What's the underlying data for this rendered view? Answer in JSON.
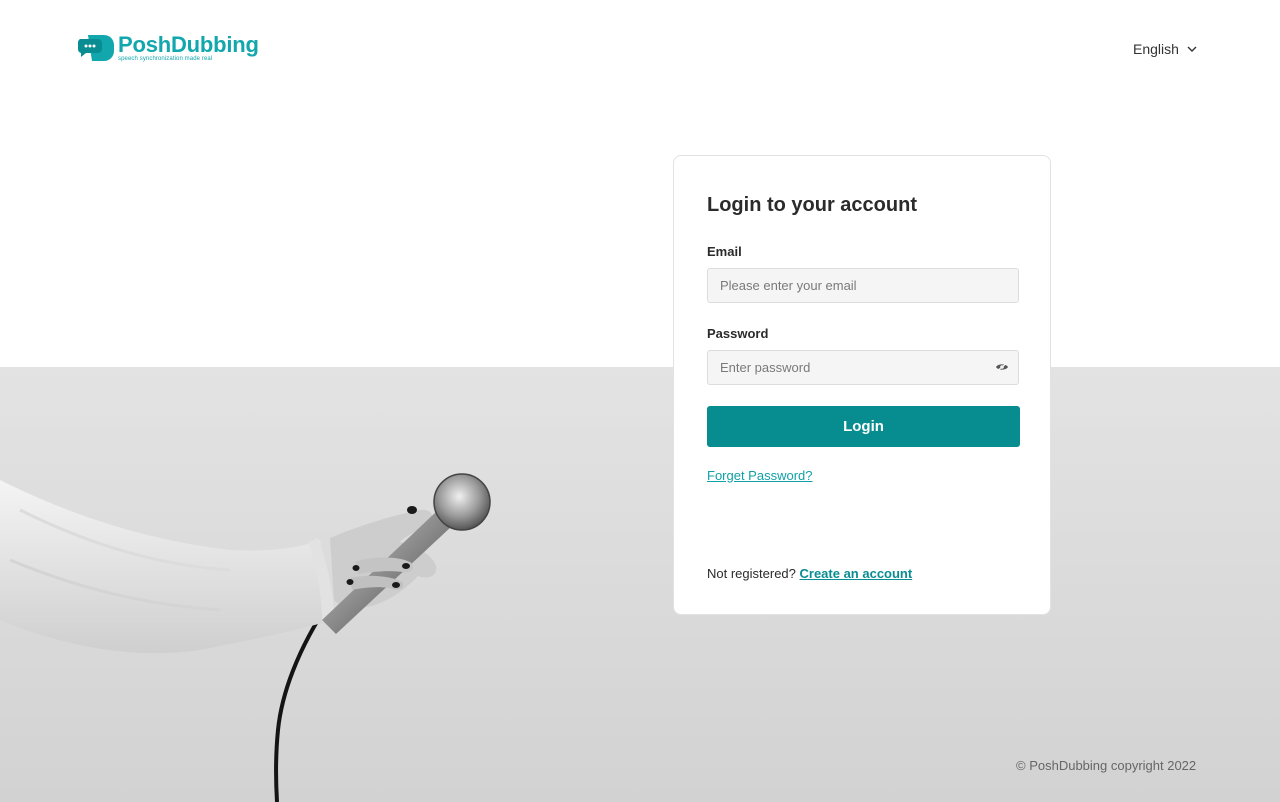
{
  "brand": {
    "name": "PoshDubbing",
    "tagline": "speech synchronization made real",
    "accent_color": "#11a7ad"
  },
  "language": {
    "selected": "English",
    "icon": "chevron-down-icon"
  },
  "login_form": {
    "title": "Login to your account",
    "email_label": "Email",
    "email_placeholder": "Please enter your email",
    "email_value": "",
    "password_label": "Password",
    "password_placeholder": "Enter password",
    "password_value": "",
    "password_toggle_icon": "eye-icon",
    "submit_label": "Login",
    "submit_color": "#078c8f",
    "forgot_label": "Forget Password?",
    "register_prompt": "Not registered?",
    "register_link": "Create an account"
  },
  "footer": {
    "copyright": "© PoshDubbing copyright 2022"
  },
  "hero_image": {
    "description_icon": "microphone-hand-image"
  }
}
